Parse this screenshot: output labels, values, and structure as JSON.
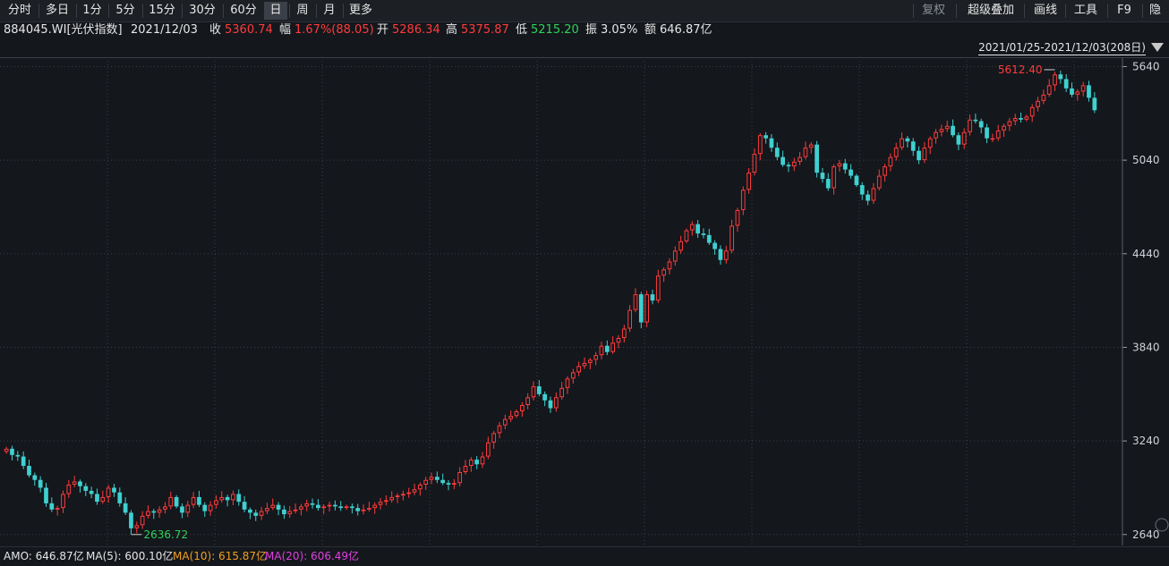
{
  "periods": {
    "tabs": [
      {
        "label": "分时",
        "active": false
      },
      {
        "label": "多日",
        "active": false
      },
      {
        "label": "1分",
        "active": false
      },
      {
        "label": "5分",
        "active": false
      },
      {
        "label": "15分",
        "active": false
      },
      {
        "label": "30分",
        "active": false
      },
      {
        "label": "60分",
        "active": false
      },
      {
        "label": "日",
        "active": true
      },
      {
        "label": "周",
        "active": false
      },
      {
        "label": "月",
        "active": false
      },
      {
        "label": "更多",
        "active": false
      }
    ]
  },
  "tools": {
    "restore_rights": "复权",
    "overlay": "超级叠加",
    "draw_line": "画线",
    "tools": "工具",
    "f9": "F9",
    "hide": "隐藏"
  },
  "quote": {
    "code_name": "884045.WI[光伏指数]",
    "date": "2021/12/03",
    "close_label": "收",
    "close": "5360.74",
    "change_label": "幅",
    "change": "1.67%(88.05)",
    "open_label": "开",
    "open": "5286.34",
    "high_label": "高",
    "high": "5375.87",
    "low_label": "低",
    "low": "5215.20",
    "amplitude_label": "振",
    "amplitude": "3.05%",
    "amount_label": "额",
    "amount": "646.87亿"
  },
  "range": {
    "label": "2021/01/25-2021/12/03(208日)"
  },
  "colors": {
    "up": "#ff3b3b",
    "down": "#3fd0d0",
    "background": "#14171c",
    "grid": "#3a3f47"
  },
  "chart_data": {
    "type": "candlestick",
    "title": "884045.WI[光伏指数]",
    "period": "daily",
    "date_range": [
      "2021/01/25",
      "2021/12/03"
    ],
    "ylim": [
      2570,
      5700
    ],
    "yticks": [
      "5640",
      "5040",
      "4440",
      "3840",
      "3240",
      "2640"
    ],
    "annotations": {
      "max": "5612.40",
      "min": "2636.72"
    },
    "last": {
      "open": 5286.34,
      "high": 5375.87,
      "low": 5215.2,
      "close": 5360.74
    },
    "closes": [
      3190,
      3150,
      3140,
      3080,
      3020,
      2990,
      2940,
      2840,
      2800,
      2810,
      2900,
      2960,
      2980,
      2950,
      2920,
      2900,
      2850,
      2880,
      2940,
      2910,
      2840,
      2780,
      2680,
      2700,
      2760,
      2790,
      2780,
      2800,
      2820,
      2880,
      2820,
      2780,
      2830,
      2880,
      2830,
      2790,
      2830,
      2860,
      2880,
      2860,
      2900,
      2850,
      2800,
      2780,
      2760,
      2790,
      2810,
      2830,
      2800,
      2770,
      2790,
      2800,
      2820,
      2840,
      2830,
      2810,
      2820,
      2830,
      2820,
      2810,
      2820,
      2810,
      2790,
      2800,
      2810,
      2830,
      2850,
      2860,
      2880,
      2890,
      2900,
      2910,
      2930,
      2960,
      2990,
      3010,
      2990,
      2970,
      2960,
      2970,
      3040,
      3080,
      3120,
      3090,
      3140,
      3230,
      3290,
      3340,
      3380,
      3400,
      3430,
      3470,
      3520,
      3590,
      3540,
      3500,
      3450,
      3520,
      3580,
      3640,
      3680,
      3720,
      3740,
      3760,
      3790,
      3850,
      3810,
      3870,
      3900,
      3960,
      4080,
      4180,
      4000,
      4180,
      4140,
      4300,
      4340,
      4390,
      4460,
      4520,
      4590,
      4630,
      4570,
      4560,
      4510,
      4470,
      4400,
      4460,
      4620,
      4720,
      4850,
      4960,
      5080,
      5200,
      5180,
      5120,
      5060,
      5010,
      5000,
      5030,
      5060,
      5120,
      5140,
      4960,
      4920,
      4860,
      5000,
      5020,
      4980,
      4940,
      4880,
      4820,
      4780,
      4860,
      4940,
      5000,
      5060,
      5120,
      5180,
      5160,
      5100,
      5040,
      5120,
      5180,
      5220,
      5240,
      5260,
      5200,
      5140,
      5220,
      5300,
      5290,
      5250,
      5180,
      5180,
      5230,
      5260,
      5290,
      5310,
      5300,
      5320,
      5380,
      5420,
      5460,
      5520,
      5590,
      5560,
      5500,
      5460,
      5480,
      5520,
      5440,
      5360
    ]
  },
  "indicators": {
    "amo": "AMO: 646.87亿",
    "ma5": "MA(5): 600.10亿",
    "ma10": "MA(10): 615.87亿",
    "ma20": "MA(20): 606.49亿"
  }
}
